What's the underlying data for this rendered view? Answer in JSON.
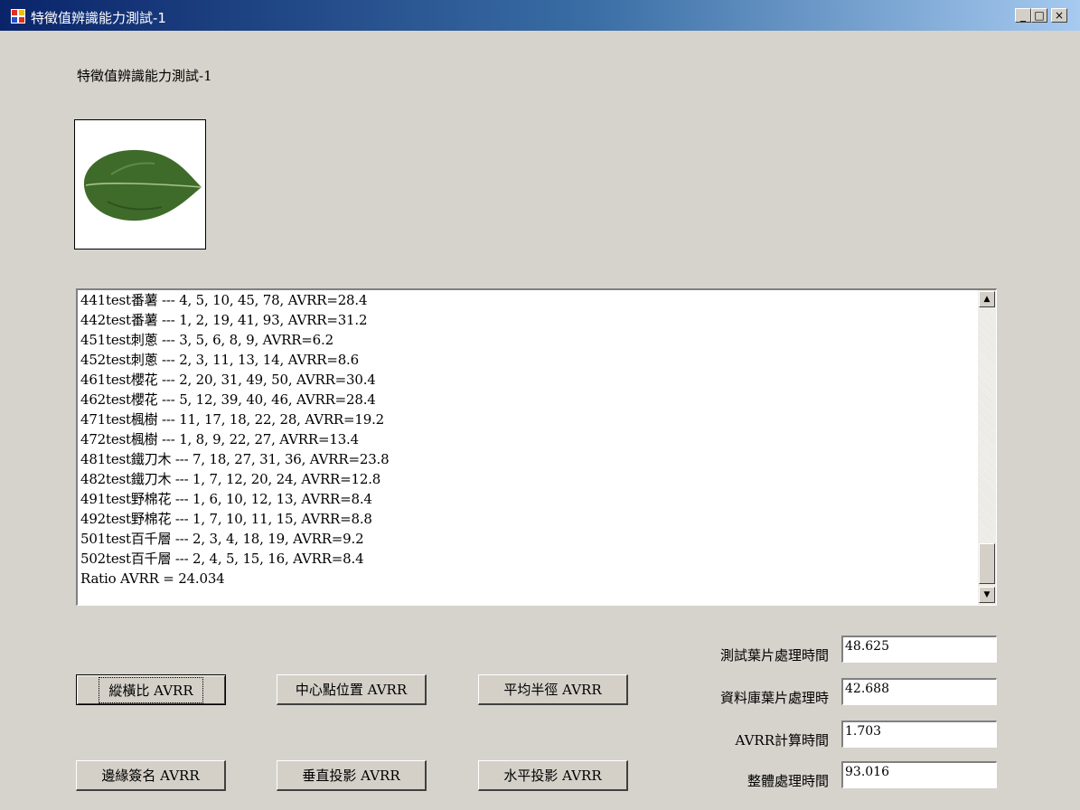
{
  "window": {
    "title": "特徵值辨識能力測試-1",
    "controls": {
      "minimize": "_",
      "maximize": "□",
      "close": "×"
    }
  },
  "header": {
    "label": "特徵值辨識能力測試-1"
  },
  "image": {
    "subject": "leaf-icon"
  },
  "results": {
    "lines": [
      "441test番薯 --- 4, 5, 10, 45, 78, AVRR=28.4",
      "442test番薯 --- 1, 2, 19, 41, 93, AVRR=31.2",
      "451test刺蔥 --- 3, 5, 6, 8, 9, AVRR=6.2",
      "452test刺蔥 --- 2, 3, 11, 13, 14, AVRR=8.6",
      "461test櫻花 --- 2, 20, 31, 49, 50, AVRR=30.4",
      "462test櫻花 --- 5, 12, 39, 40, 46, AVRR=28.4",
      "471test楓樹 --- 11, 17, 18, 22, 28, AVRR=19.2",
      "472test楓樹 --- 1, 8, 9, 22, 27, AVRR=13.4",
      "481test鐵刀木 --- 7, 18, 27, 31, 36, AVRR=23.8",
      "482test鐵刀木 --- 1, 7, 12, 20, 24, AVRR=12.8",
      "491test野棉花 --- 1, 6, 10, 12, 13, AVRR=8.4",
      "492test野棉花 --- 1, 7, 10, 11, 15, AVRR=8.8",
      "501test百千層 --- 2, 3, 4, 18, 19, AVRR=9.2",
      "502test百千層 --- 2, 4, 5, 15, 16, AVRR=8.4",
      "Ratio AVRR = 24.034"
    ]
  },
  "buttons": {
    "ratio": "縱橫比 AVRR",
    "center": "中心點位置 AVRR",
    "radius": "平均半徑 AVRR",
    "edge": "邊緣簽名 AVRR",
    "vertical": "垂直投影 AVRR",
    "horizontal": "水平投影 AVRR"
  },
  "timing": {
    "test_label": "測試葉片處理時間",
    "test_value": "48.625",
    "db_label": "資料庫葉片處理時",
    "db_value": "42.688",
    "avrr_label": "AVRR計算時間",
    "avrr_value": "1.703",
    "total_label": "整體處理時間",
    "total_value": "93.016"
  }
}
